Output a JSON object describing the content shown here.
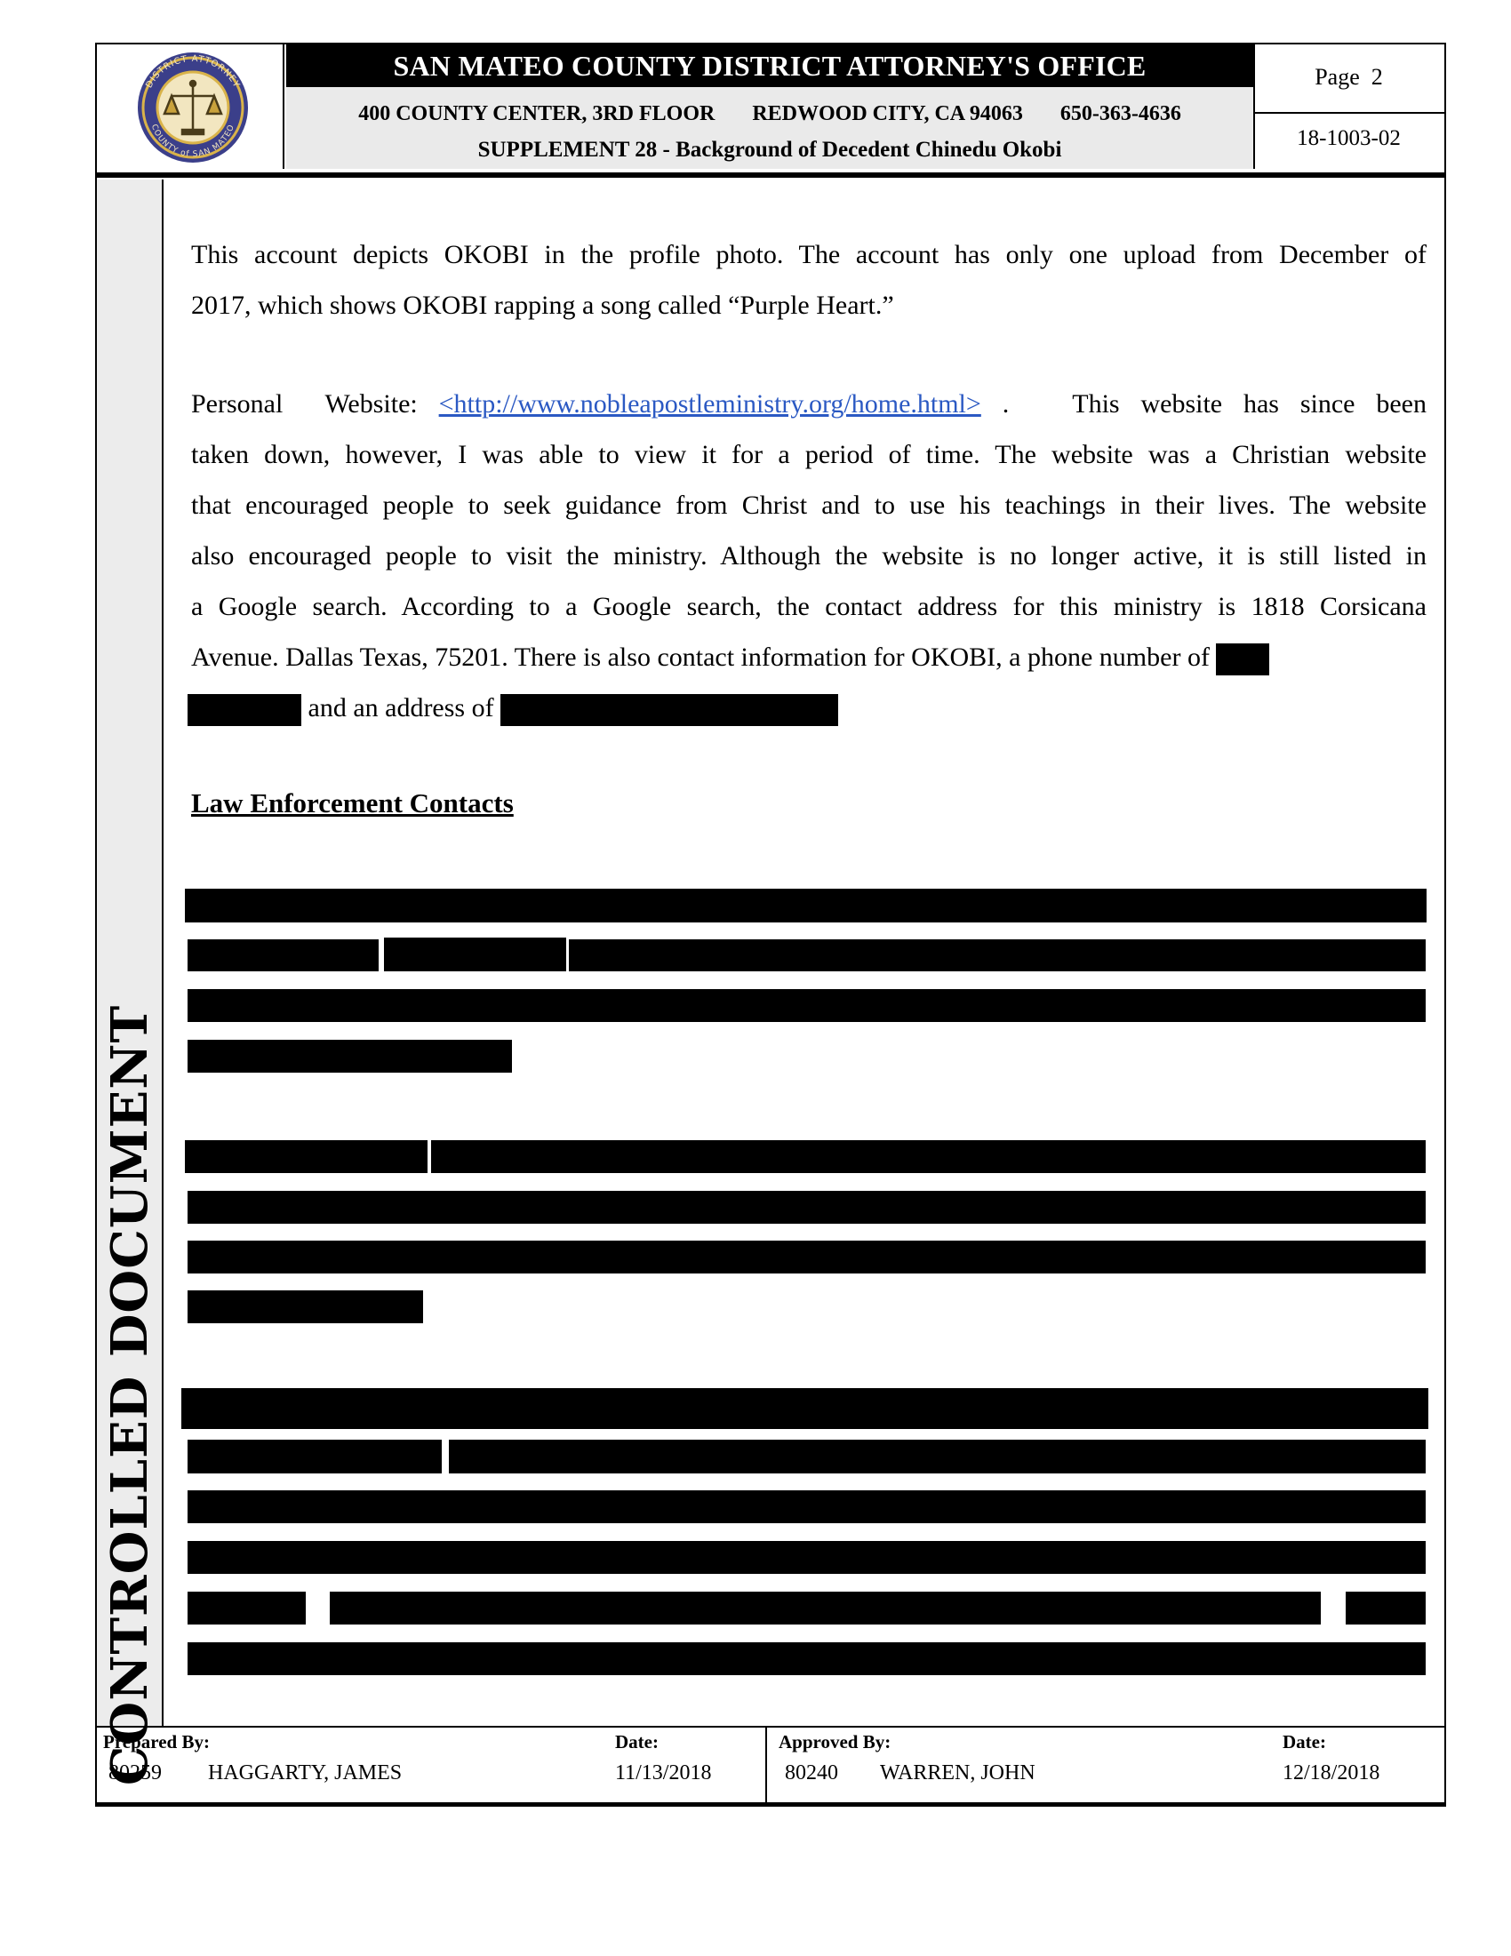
{
  "header": {
    "office_title": "SAN MATEO COUNTY DISTRICT ATTORNEY'S OFFICE",
    "address": "400 COUNTY CENTER, 3RD FLOOR",
    "city": "REDWOOD CITY, CA 94063",
    "phone": "650-363-4636",
    "supplement": "SUPPLEMENT 28 - Background of Decedent Chinedu Okobi",
    "page_label": "Page  2",
    "case_number": "18-1003-02",
    "seal_top_text": "DISTRICT ATTORNEY",
    "seal_bottom_text": "COUNTY of SAN MATEO"
  },
  "side_stamp": "CONTROLLED DOCUMENT",
  "body": {
    "para1_line1": "This account depicts OKOBI in the profile photo.  The account has only one upload from December of",
    "para1_line2": "2017, which shows OKOBI rapping a song called “Purple Heart.”",
    "para2_prefix": "Personal  Website:",
    "para2_link": "<http://www.nobleapostleministry.org/home.html>",
    "para2_suffix": ".   This website has since been",
    "para2_line2": "taken down, however, I was able to view it for a period of time.  The website was a Christian website",
    "para2_line3": "that encouraged people to seek guidance from Christ and to use his teachings in their lives.  The website",
    "para2_line4": "also encouraged people to visit the ministry.  Although the website is no longer active, it is still listed in",
    "para2_line5": "a Google search.  According to a Google search, the contact address for this ministry is 1818 Corsicana",
    "para2_line6": "Avenue. Dallas Texas, 75201. There is also contact information for OKOBI, a phone number of",
    "para2_line7": "and an address of",
    "section_heading": "Law Enforcement Contacts"
  },
  "footer": {
    "prepared_label": "Prepared By:",
    "prepared_id": "80259",
    "prepared_name": "HAGGARTY, JAMES",
    "prepared_date_label": "Date:",
    "prepared_date": "11/13/2018",
    "approved_label": "Approved By:",
    "approved_id": "80240",
    "approved_name": "WARREN, JOHN",
    "approved_date_label": "Date:",
    "approved_date": "12/18/2018"
  }
}
